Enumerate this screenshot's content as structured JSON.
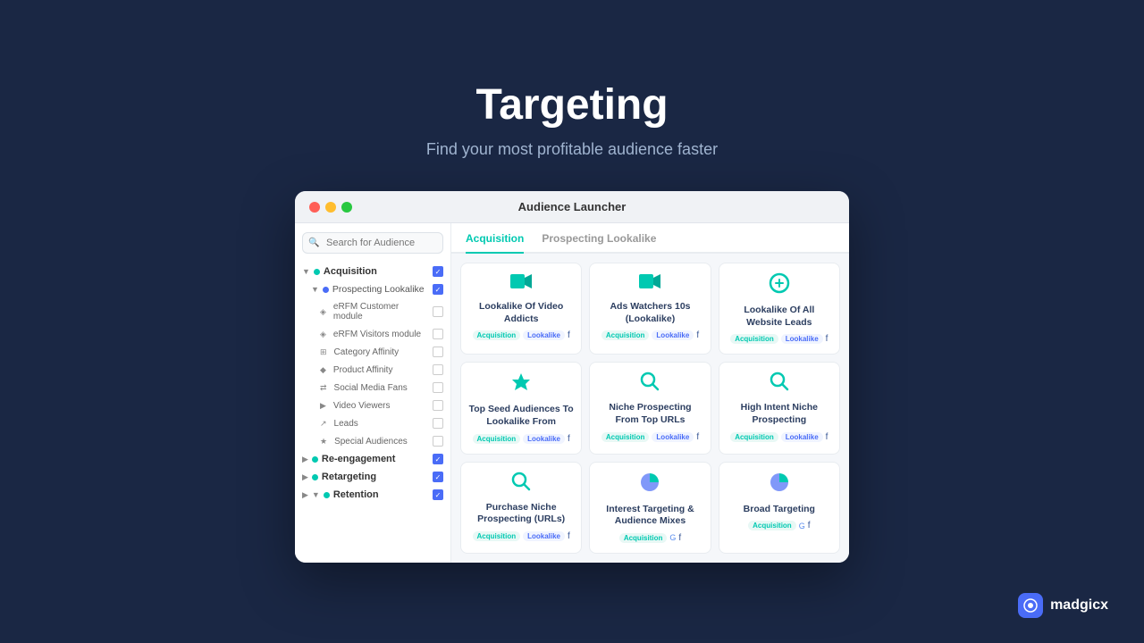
{
  "page": {
    "title": "Targeting",
    "subtitle": "Find your most profitable audience faster"
  },
  "window": {
    "title": "Audience Launcher"
  },
  "tabs": [
    {
      "label": "Acquisition",
      "active": true
    },
    {
      "label": "Prospecting Lookalike",
      "active": false
    }
  ],
  "sidebar": {
    "search_placeholder": "Search for Audience",
    "items": [
      {
        "label": "Acquisition",
        "type": "parent",
        "dot": "teal",
        "checked": true
      },
      {
        "label": "Prospecting Lookalike",
        "type": "child",
        "dot": "blue",
        "checked": true
      },
      {
        "label": "eRFM Customer module",
        "type": "leaf",
        "checked": false
      },
      {
        "label": "eRFM Visitors module",
        "type": "leaf",
        "checked": false
      },
      {
        "label": "Category Affinity",
        "type": "leaf",
        "checked": false
      },
      {
        "label": "Product Affinity",
        "type": "leaf",
        "checked": false
      },
      {
        "label": "Social Media Fans",
        "type": "leaf",
        "checked": false
      },
      {
        "label": "Video Viewers",
        "type": "leaf",
        "checked": false
      },
      {
        "label": "Leads",
        "type": "leaf",
        "checked": false
      },
      {
        "label": "Special Audiences",
        "type": "leaf",
        "checked": false
      },
      {
        "label": "Re-engagement",
        "type": "parent",
        "dot": "teal",
        "checked": true
      },
      {
        "label": "Retargeting",
        "type": "parent",
        "dot": "teal",
        "checked": true
      },
      {
        "label": "Retention",
        "type": "parent",
        "dot": "teal",
        "checked": true
      }
    ]
  },
  "cards": [
    {
      "id": "lookalike-video",
      "icon": "🎥",
      "title": "Lookalike Of Video Addicts",
      "tags": [
        "Acquisition",
        "Lookalike"
      ],
      "platform": "fb"
    },
    {
      "id": "ads-watchers",
      "icon": "🎬",
      "title": "Ads Watchers 10s (Lookalike)",
      "tags": [
        "Acquisition",
        "Lookalike"
      ],
      "platform": "fb"
    },
    {
      "id": "lookalike-leads",
      "icon": "©",
      "title": "Lookalike Of All Website Leads",
      "tags": [
        "Acquisition",
        "Lookalike"
      ],
      "platform": "fb"
    },
    {
      "id": "top-seed",
      "icon": "⭐",
      "title": "Top Seed Audiences To Lookalike From",
      "tags": [
        "Acquisition",
        "Lookalike"
      ],
      "platform": "fb"
    },
    {
      "id": "niche-urls",
      "icon": "🔍",
      "title": "Niche Prospecting From Top URLs",
      "tags": [
        "Acquisition",
        "Lookalike"
      ],
      "platform": "fb"
    },
    {
      "id": "high-intent",
      "icon": "🔍",
      "title": "High Intent Niche Prospecting",
      "tags": [
        "Acquisition",
        "Lookalike"
      ],
      "platform": "fb"
    },
    {
      "id": "purchase-niche",
      "icon": "🔍",
      "title": "Purchase Niche Prospecting (URLs)",
      "tags": [
        "Acquisition",
        "Lookalike"
      ],
      "platform": "fb"
    },
    {
      "id": "interest-targeting",
      "icon": "🥧",
      "title": "Interest Targeting & Audience Mixes",
      "tags": [
        "Acquisition"
      ],
      "platform": "fb_google"
    },
    {
      "id": "broad-targeting",
      "icon": "🥧",
      "title": "Broad Targeting",
      "tags": [
        "Acquisition"
      ],
      "platform": "fb_google"
    }
  ],
  "logo": {
    "name": "madgicx",
    "icon_char": "m"
  }
}
